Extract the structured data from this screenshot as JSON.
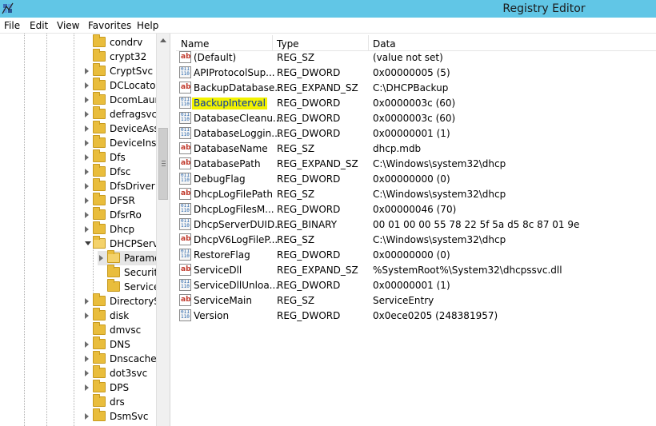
{
  "window": {
    "title": "Registry Editor"
  },
  "menu": [
    "File",
    "Edit",
    "View",
    "Favorites",
    "Help"
  ],
  "tree": {
    "items": [
      {
        "label": "condrv",
        "expander": false,
        "open": false
      },
      {
        "label": "crypt32",
        "expander": false,
        "open": false
      },
      {
        "label": "CryptSvc",
        "expander": true,
        "open": false
      },
      {
        "label": "DCLocator",
        "expander": true,
        "open": false
      },
      {
        "label": "DcomLaun",
        "expander": true,
        "open": false
      },
      {
        "label": "defragsvc",
        "expander": true,
        "open": false
      },
      {
        "label": "DeviceAsso",
        "expander": true,
        "open": false
      },
      {
        "label": "DeviceInsta",
        "expander": true,
        "open": false
      },
      {
        "label": "Dfs",
        "expander": true,
        "open": false
      },
      {
        "label": "Dfsc",
        "expander": true,
        "open": false
      },
      {
        "label": "DfsDriver",
        "expander": true,
        "open": false
      },
      {
        "label": "DFSR",
        "expander": true,
        "open": false
      },
      {
        "label": "DfsrRo",
        "expander": true,
        "open": false
      },
      {
        "label": "Dhcp",
        "expander": true,
        "open": false
      },
      {
        "label": "DHCPServe",
        "expander": true,
        "open": true
      },
      {
        "label": "Parame",
        "expander": true,
        "open": false,
        "child": true,
        "selected": true
      },
      {
        "label": "Security",
        "expander": false,
        "open": false,
        "child": true
      },
      {
        "label": "Service",
        "expander": false,
        "open": false,
        "child": true
      },
      {
        "label": "DirectorySe",
        "expander": true,
        "open": false
      },
      {
        "label": "disk",
        "expander": true,
        "open": false
      },
      {
        "label": "dmvsc",
        "expander": false,
        "open": false
      },
      {
        "label": "DNS",
        "expander": true,
        "open": false
      },
      {
        "label": "Dnscache",
        "expander": true,
        "open": false
      },
      {
        "label": "dot3svc",
        "expander": true,
        "open": false
      },
      {
        "label": "DPS",
        "expander": true,
        "open": false
      },
      {
        "label": "drs",
        "expander": false,
        "open": false
      },
      {
        "label": "DsmSvc",
        "expander": true,
        "open": false
      }
    ]
  },
  "columns": {
    "name": "Name",
    "type": "Type",
    "data": "Data"
  },
  "values": [
    {
      "name": "(Default)",
      "type": "REG_SZ",
      "data": "(value not set)",
      "icon": "sz"
    },
    {
      "name": "APIProtocolSup...",
      "type": "REG_DWORD",
      "data": "0x00000005 (5)",
      "icon": "bin"
    },
    {
      "name": "BackupDatabase...",
      "type": "REG_EXPAND_SZ",
      "data": "C:\\DHCPBackup",
      "icon": "sz"
    },
    {
      "name": "BackupInterval",
      "type": "REG_DWORD",
      "data": "0x0000003c (60)",
      "icon": "bin",
      "highlight": true
    },
    {
      "name": "DatabaseCleanu...",
      "type": "REG_DWORD",
      "data": "0x0000003c (60)",
      "icon": "bin"
    },
    {
      "name": "DatabaseLoggin...",
      "type": "REG_DWORD",
      "data": "0x00000001 (1)",
      "icon": "bin"
    },
    {
      "name": "DatabaseName",
      "type": "REG_SZ",
      "data": "dhcp.mdb",
      "icon": "sz"
    },
    {
      "name": "DatabasePath",
      "type": "REG_EXPAND_SZ",
      "data": "C:\\Windows\\system32\\dhcp",
      "icon": "sz"
    },
    {
      "name": "DebugFlag",
      "type": "REG_DWORD",
      "data": "0x00000000 (0)",
      "icon": "bin"
    },
    {
      "name": "DhcpLogFilePath",
      "type": "REG_SZ",
      "data": "C:\\Windows\\system32\\dhcp",
      "icon": "sz"
    },
    {
      "name": "DhcpLogFilesM...",
      "type": "REG_DWORD",
      "data": "0x00000046 (70)",
      "icon": "bin"
    },
    {
      "name": "DhcpServerDUID...",
      "type": "REG_BINARY",
      "data": "00 01 00 00 55 78 22 5f 5a d5 8c 87 01 9e",
      "icon": "bin"
    },
    {
      "name": "DhcpV6LogFileP...",
      "type": "REG_SZ",
      "data": "C:\\Windows\\system32\\dhcp",
      "icon": "sz"
    },
    {
      "name": "RestoreFlag",
      "type": "REG_DWORD",
      "data": "0x00000000 (0)",
      "icon": "bin"
    },
    {
      "name": "ServiceDll",
      "type": "REG_EXPAND_SZ",
      "data": "%SystemRoot%\\System32\\dhcpssvc.dll",
      "icon": "sz"
    },
    {
      "name": "ServiceDllUnloa...",
      "type": "REG_DWORD",
      "data": "0x00000001 (1)",
      "icon": "bin"
    },
    {
      "name": "ServiceMain",
      "type": "REG_SZ",
      "data": "ServiceEntry",
      "icon": "sz"
    },
    {
      "name": "Version",
      "type": "REG_DWORD",
      "data": "0x0ece0205 (248381957)",
      "icon": "bin"
    }
  ]
}
